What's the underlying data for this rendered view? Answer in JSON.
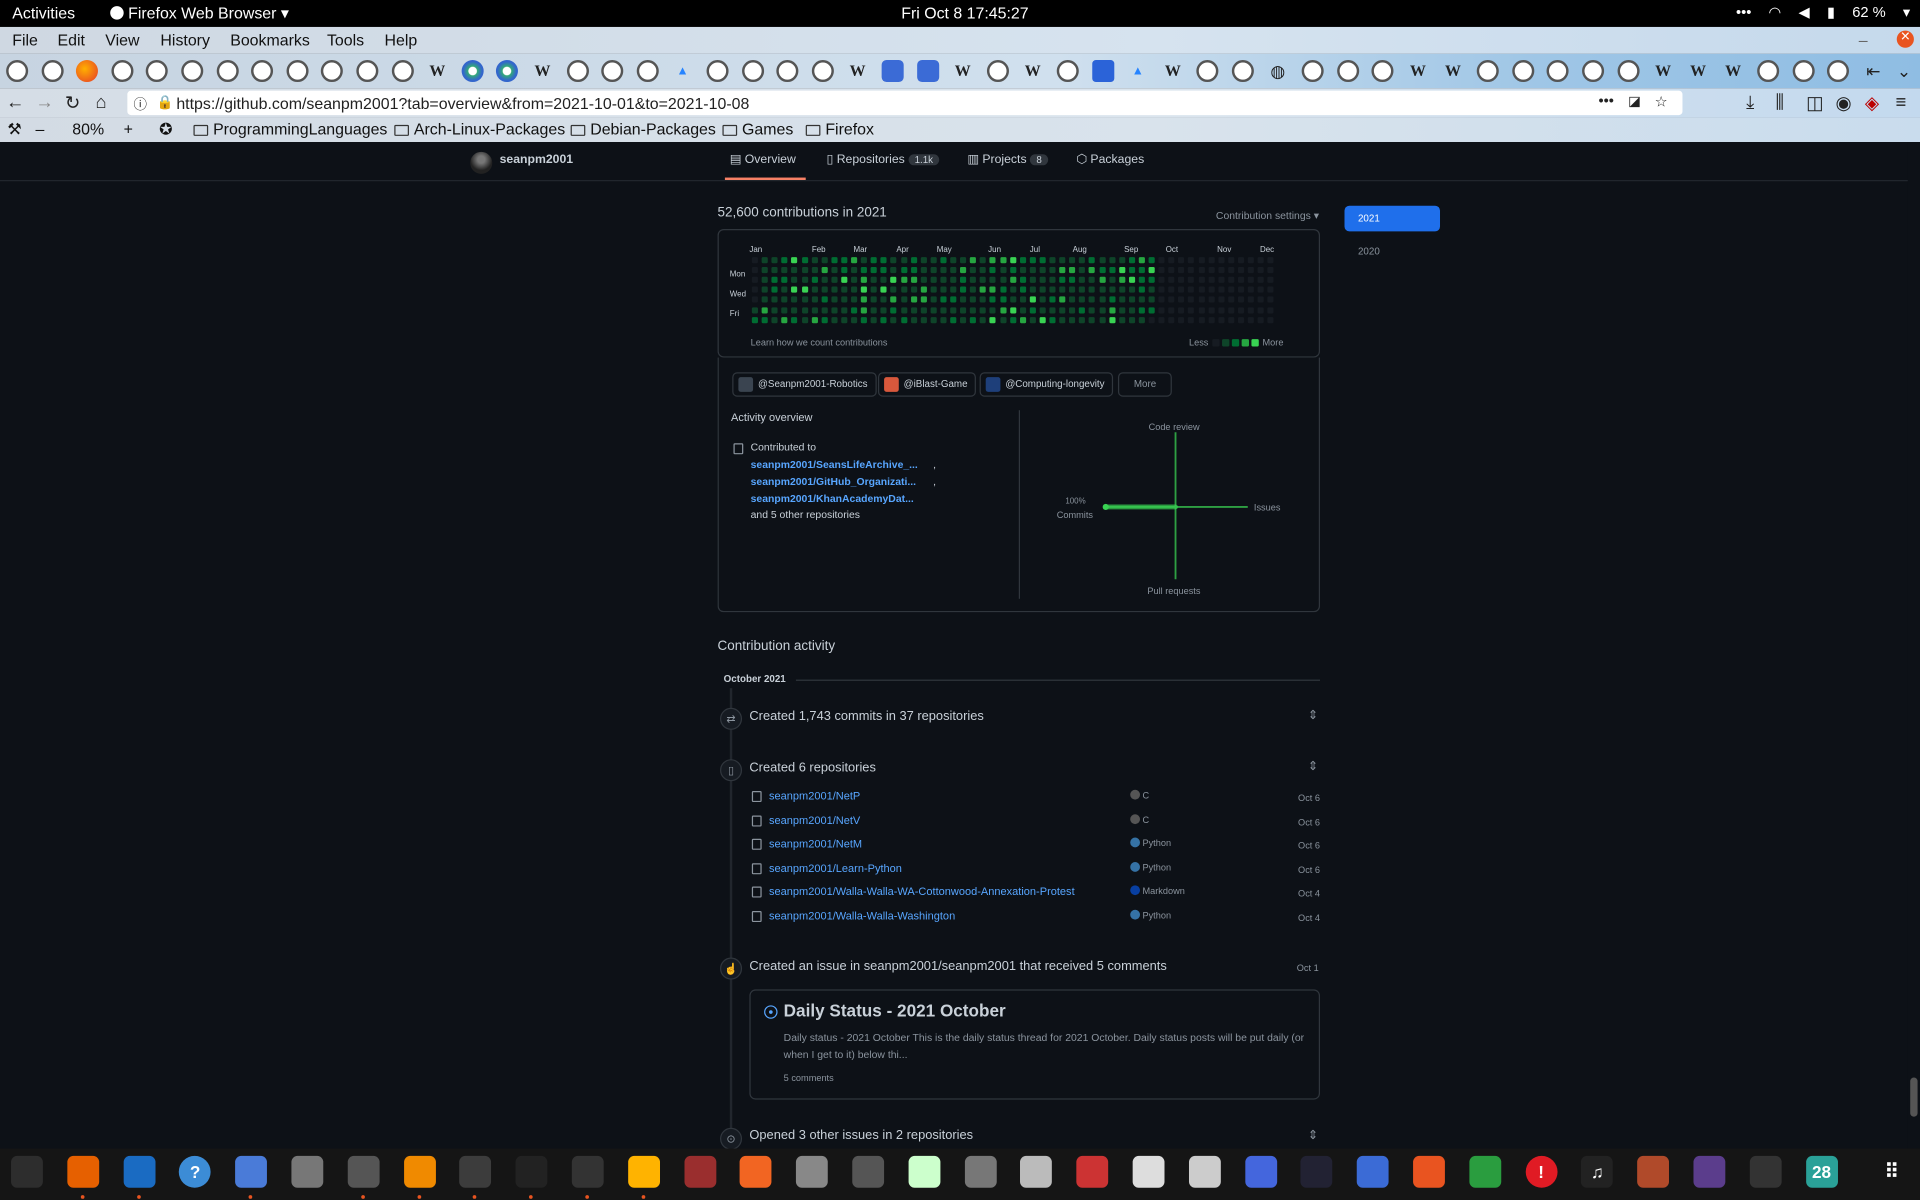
{
  "system_bar": {
    "activities": "Activities",
    "app_name": "Firefox Web Browser",
    "clock": "Fri Oct 8  17:45:27",
    "battery": "62 %",
    "menu_dots": "•••"
  },
  "menu": [
    "File",
    "Edit",
    "View",
    "History",
    "Bookmarks",
    "Tools",
    "Help"
  ],
  "tabs": [
    "github",
    "github",
    "firefox",
    "github",
    "github",
    "github",
    "github",
    "github",
    "github",
    "github",
    "github",
    "github",
    "wikipedia",
    "wikimedia",
    "wikimedia",
    "wikipedia",
    "github",
    "github",
    "github",
    "atlassian",
    "github",
    "github",
    "github",
    "github",
    "wikipedia",
    "rss",
    "rss",
    "wikipedia",
    "github",
    "wikipedia",
    "github",
    "shield",
    "atlassian",
    "wikipedia",
    "github",
    "github",
    "globe",
    "github",
    "github",
    "github",
    "wikipedia",
    "wikipedia",
    "github",
    "github",
    "github",
    "github",
    "github",
    "wikipedia",
    "wikipedia",
    "wikipedia",
    "github",
    "github",
    "github"
  ],
  "navigation": {
    "url": "https://github.com/seanpm2001?tab=overview&from=2021-10-01&to=2021-10-08",
    "zoom": "80%",
    "bookmarks": [
      "ProgrammingLanguages",
      "Arch-Linux-Packages",
      "Debian-Packages",
      "Games",
      "Firefox"
    ]
  },
  "profile_nav": {
    "username": "seanpm2001",
    "tabs": [
      {
        "label": "Overview",
        "count": ""
      },
      {
        "label": "Repositories",
        "count": "1.1k"
      },
      {
        "label": "Projects",
        "count": "8"
      },
      {
        "label": "Packages",
        "count": ""
      }
    ]
  },
  "contributions": {
    "heading": "52,600 contributions in 2021",
    "settings": "Contribution settings ▾",
    "months": [
      "Jan",
      "Feb",
      "Mar",
      "Apr",
      "May",
      "Jun",
      "Jul",
      "Aug",
      "Sep",
      "Oct",
      "Nov",
      "Dec"
    ],
    "days": [
      "Mon",
      "Wed",
      "Fri"
    ],
    "learn_link": "Learn how we count contributions",
    "legend_less": "Less",
    "legend_more": "More",
    "colors": {
      "empty": "#161b22",
      "l1": "#0e4429",
      "l2": "#006d32",
      "l3": "#26a641",
      "l4": "#39d353"
    }
  },
  "orgs": [
    {
      "name": "@Seanpm2001-Robotics",
      "color": "#3a4450"
    },
    {
      "name": "@iBlast-Game",
      "color": "#d8583c"
    },
    {
      "name": "@Computing-longevity",
      "color": "#1e3f7a"
    }
  ],
  "orgs_more": "More",
  "activity_overview": {
    "title": "Activity overview",
    "contributed_to": "Contributed to",
    "repos": [
      "seanpm2001/SeansLifeArchive_...",
      "seanpm2001/GitHub_Organizati...",
      "seanpm2001/KhanAcademyDat..."
    ],
    "other": "and 5 other repositories",
    "axes": {
      "code_review": "Code review",
      "issues": "Issues",
      "pull_requests": "Pull requests",
      "commits": "Commits",
      "commits_pct": "100%"
    }
  },
  "years": [
    "2021",
    "2020"
  ],
  "contribution_activity": {
    "title": "Contribution activity",
    "month": "October 2021",
    "commits_summary": "Created 1,743 commits in 37 repositories",
    "repos_summary": "Created 6 repositories",
    "created_repos": [
      {
        "name": "seanpm2001/NetP",
        "lang": "C",
        "color": "#555555",
        "date": "Oct 6"
      },
      {
        "name": "seanpm2001/NetV",
        "lang": "C",
        "color": "#555555",
        "date": "Oct 6"
      },
      {
        "name": "seanpm2001/NetM",
        "lang": "Python",
        "color": "#3572A5",
        "date": "Oct 6"
      },
      {
        "name": "seanpm2001/Learn-Python",
        "lang": "Python",
        "color": "#3572A5",
        "date": "Oct 6"
      },
      {
        "name": "seanpm2001/Walla-Walla-WA-Cottonwood-Annexation-Protest",
        "lang": "Markdown",
        "color": "#083fa1",
        "date": "Oct 4"
      },
      {
        "name": "seanpm2001/Walla-Walla-Washington",
        "lang": "Python",
        "color": "#3572A5",
        "date": "Oct 4"
      }
    ],
    "issue_summary": "Created an issue in seanpm2001/seanpm2001 that received 5 comments",
    "issue_date": "Oct 1",
    "issue": {
      "title": "Daily Status - 2021 October",
      "body": "Daily status - 2021 October This is the daily status thread for 2021 October. Daily status posts will be put daily (or when I get to it) below thi...",
      "comments": "5 comments"
    },
    "other_issues": "Opened 3 other issues in 2 repositories"
  },
  "dock": {
    "calendar_day": "28",
    "apps": [
      "system-monitor",
      "firefox",
      "text-editor",
      "help",
      "notes",
      "files",
      "settings",
      "vlc",
      "puzzle",
      "inkscape",
      "terminal",
      "calculator",
      "charts",
      "app-store",
      "search",
      "disk",
      "image",
      "scanner",
      "pdf",
      "archive",
      "characters",
      "font",
      "tasks",
      "vim",
      "screen",
      "update",
      "spreadsheet",
      "alert",
      "music",
      "game",
      "camera",
      "ninja",
      "calendar"
    ]
  }
}
